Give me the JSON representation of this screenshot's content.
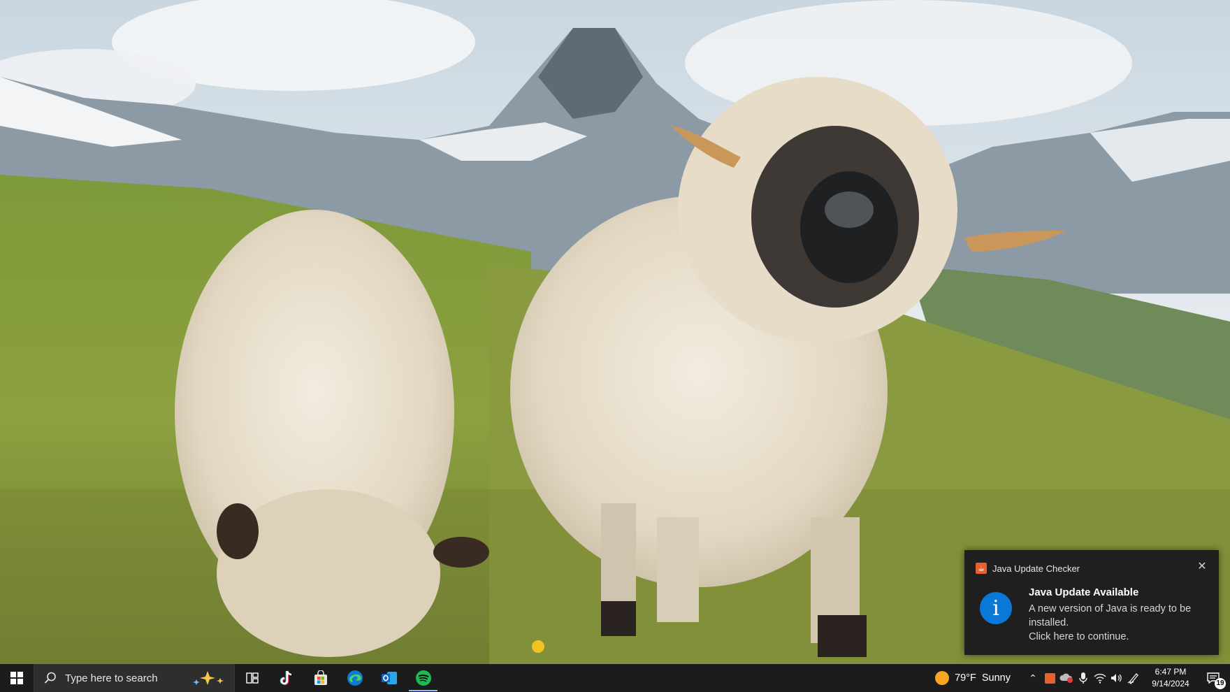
{
  "desktop": {
    "wallpaper": "alpine-meadow-sheep-matterhorn"
  },
  "toast": {
    "app_name": "Java Update Checker",
    "title": "Java Update Available",
    "line1": "A new version of Java is ready to be installed.",
    "line2": "Click here to continue.",
    "icon": "info-icon",
    "close_icon": "close-icon"
  },
  "taskbar": {
    "start_icon": "windows-logo-icon",
    "search_placeholder": "Type here to search",
    "apps": [
      {
        "name": "task-view",
        "icon": "task-view-icon"
      },
      {
        "name": "tiktok",
        "icon": "tiktok-icon"
      },
      {
        "name": "microsoft-store",
        "icon": "store-icon"
      },
      {
        "name": "edge",
        "icon": "edge-icon"
      },
      {
        "name": "outlook",
        "icon": "outlook-icon"
      },
      {
        "name": "spotify",
        "icon": "spotify-icon",
        "active": true
      }
    ],
    "weather": {
      "temp": "79°F",
      "condition": "Sunny"
    },
    "clock": {
      "time": "6:47 PM",
      "date": "9/14/2024"
    },
    "notifications": {
      "count": "19"
    }
  },
  "colors": {
    "taskbar": "#1c1c1c",
    "toast_bg": "#1f1f1f",
    "info_blue": "#0a78d7",
    "java_orange": "#e8612c",
    "spotify_green": "#1db954"
  }
}
